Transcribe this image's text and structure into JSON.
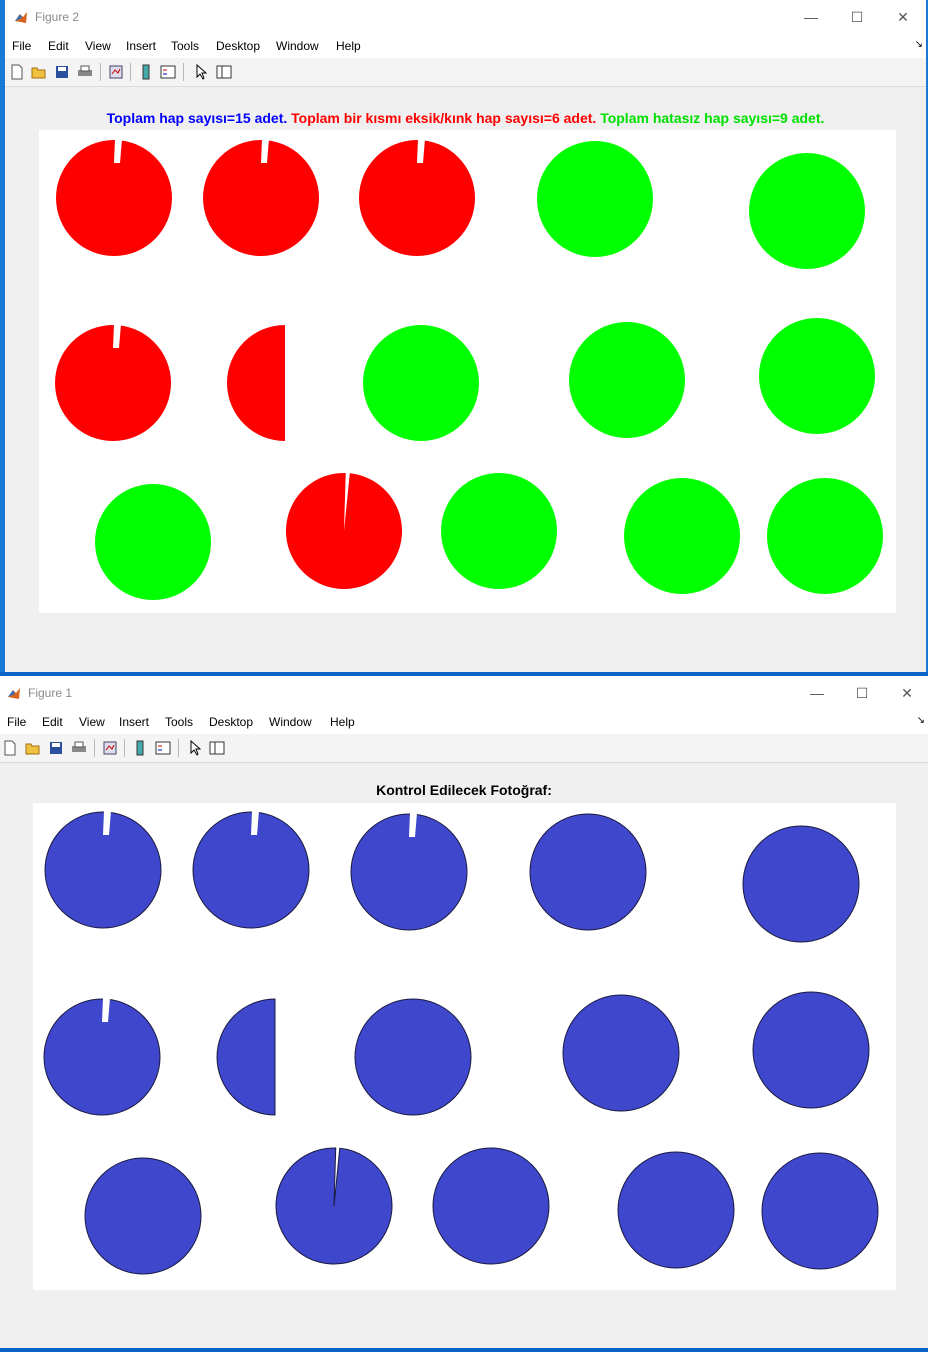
{
  "windows": [
    {
      "id": "fig2",
      "title": "Figure 2",
      "title_parts": [
        {
          "text": "Toplam hap sayısı=15 adet.",
          "color": "#0000ff"
        },
        {
          "text": "Toplam bir kısmı eksik/kınk hap sayısı=6 adet.",
          "color": "#ff0000"
        },
        {
          "text": "Toplam hatasız hap sayısı=9 adet.",
          "color": "#00e000"
        }
      ]
    },
    {
      "id": "fig1",
      "title": "Figure 1",
      "figure_title": "Kontrol Edilecek Fotoğraf:"
    }
  ],
  "menu": [
    "File",
    "Edit",
    "View",
    "Insert",
    "Tools",
    "Desktop",
    "Window",
    "Help"
  ],
  "window_controls": {
    "minimize": "—",
    "maximize": "☐",
    "close": "✕"
  },
  "toolbar_icons": [
    "new-figure-icon",
    "open-file-icon",
    "save-icon",
    "print-icon",
    "link-plot-icon",
    "colorbar-icon",
    "legend-icon",
    "edit-plot-icon",
    "property-inspector-icon"
  ],
  "colors": {
    "defective": "#ff0000",
    "intact": "#00ff00",
    "original": "#3f48cc"
  },
  "pills": [
    {
      "status": "defective",
      "defect": "notch"
    },
    {
      "status": "defective",
      "defect": "notch"
    },
    {
      "status": "defective",
      "defect": "notch"
    },
    {
      "status": "intact"
    },
    {
      "status": "intact"
    },
    {
      "status": "defective",
      "defect": "notch"
    },
    {
      "status": "defective",
      "defect": "half"
    },
    {
      "status": "intact"
    },
    {
      "status": "intact"
    },
    {
      "status": "intact"
    },
    {
      "status": "intact"
    },
    {
      "status": "defective",
      "defect": "wedge"
    },
    {
      "status": "intact"
    },
    {
      "status": "intact"
    },
    {
      "status": "intact"
    }
  ]
}
